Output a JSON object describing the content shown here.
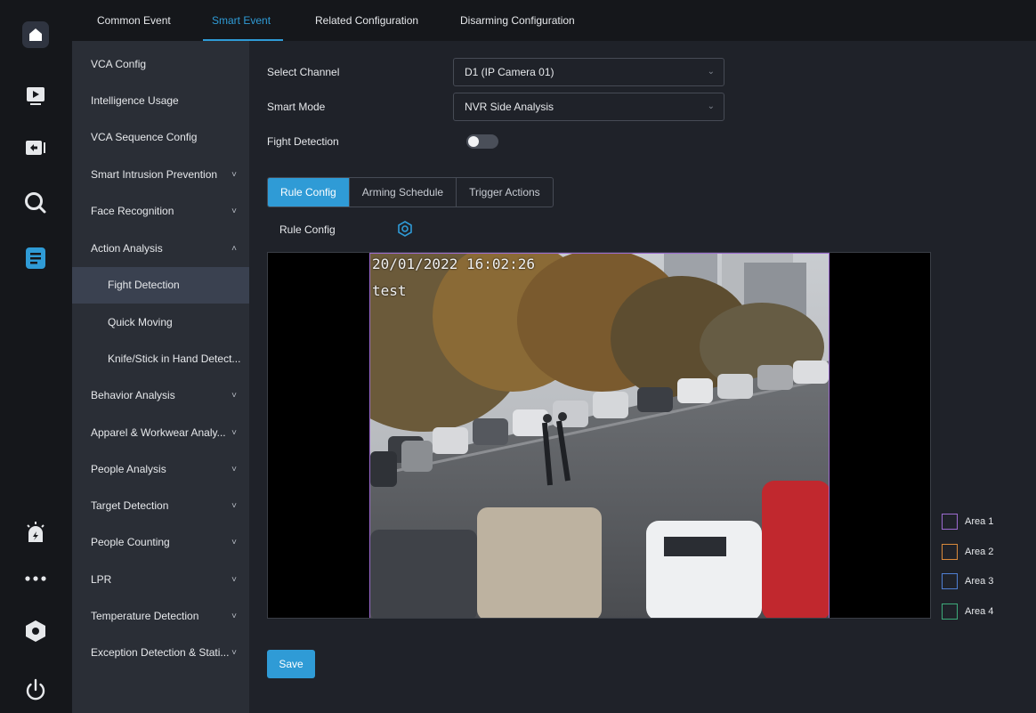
{
  "rail": {
    "items": [
      {
        "icon": "home-icon",
        "active": true
      },
      {
        "icon": "playback-icon"
      },
      {
        "icon": "backup-icon"
      },
      {
        "icon": "search-icon"
      },
      {
        "icon": "configuration-icon",
        "active": true
      },
      {
        "icon": "alarm-icon"
      },
      {
        "icon": "more-icon"
      },
      {
        "icon": "maintenance-icon"
      },
      {
        "icon": "power-icon"
      }
    ]
  },
  "top_tabs": [
    {
      "label": "Common Event"
    },
    {
      "label": "Smart Event",
      "active": true
    },
    {
      "label": "Related Configuration"
    },
    {
      "label": "Disarming Configuration"
    }
  ],
  "menu": {
    "items": [
      {
        "label": "VCA Config"
      },
      {
        "label": "Intelligence Usage"
      },
      {
        "label": "VCA Sequence Config"
      },
      {
        "label": "Smart Intrusion Prevention",
        "chevron": "˅"
      },
      {
        "label": "Face Recognition",
        "chevron": "˅"
      },
      {
        "label": "Action Analysis",
        "chevron": "˄",
        "expanded": true
      },
      {
        "label": "Fight Detection",
        "sub": true,
        "active": true
      },
      {
        "label": "Quick Moving",
        "sub": true
      },
      {
        "label": "Knife/Stick in Hand Detect...",
        "sub": true
      },
      {
        "label": "Behavior Analysis",
        "chevron": "˅"
      },
      {
        "label": "Apparel & Workwear Analy...",
        "chevron": "˅"
      },
      {
        "label": "People Analysis",
        "chevron": "˅"
      },
      {
        "label": "Target Detection",
        "chevron": "˅"
      },
      {
        "label": "People Counting",
        "chevron": "˅"
      },
      {
        "label": "LPR",
        "chevron": "˅"
      },
      {
        "label": "Temperature Detection",
        "chevron": "˅"
      },
      {
        "label": "Exception Detection & Stati...",
        "chevron": "˅"
      }
    ]
  },
  "form": {
    "channel_label": "Select Channel",
    "channel_value": "D1 (IP Camera 01)",
    "mode_label": "Smart Mode",
    "mode_value": "NVR Side Analysis",
    "fight_label": "Fight Detection",
    "fight_enabled": false
  },
  "sub_tabs": [
    {
      "label": "Rule Config",
      "active": true
    },
    {
      "label": "Arming Schedule"
    },
    {
      "label": "Trigger Actions"
    }
  ],
  "rule_config_label": "Rule Config",
  "video": {
    "timestamp": "20/01/2022 16:02:26",
    "camera_name": "test"
  },
  "areas": [
    {
      "label": "Area 1",
      "color": "#9c6bd0"
    },
    {
      "label": "Area 2",
      "color": "#d9893b"
    },
    {
      "label": "Area 3",
      "color": "#4f7fd4"
    },
    {
      "label": "Area 4",
      "color": "#3daa7a"
    }
  ],
  "save_label": "Save",
  "colors": {
    "accent": "#2f9bd6",
    "rail_bg": "#15171b",
    "menu_bg": "#2a2e36",
    "main_bg": "#1f2229"
  }
}
